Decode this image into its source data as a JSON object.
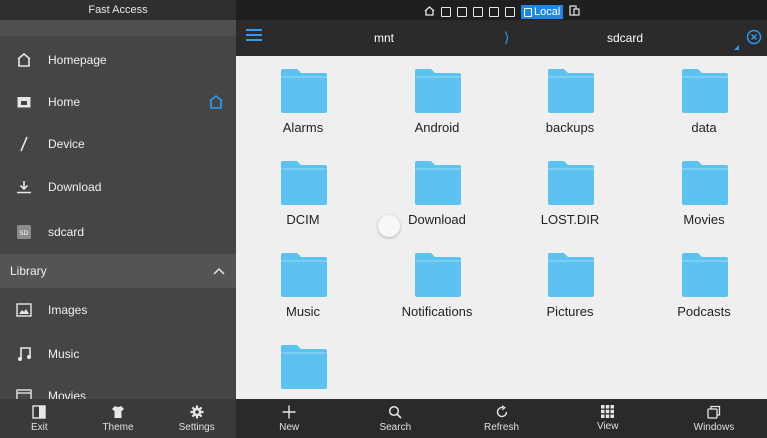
{
  "sidebar": {
    "title": "Fast Access",
    "items": [
      {
        "label": "Homepage",
        "icon": "homepage-icon"
      },
      {
        "label": "Home",
        "icon": "folder-home-icon",
        "trail_icon": "home-outline-icon"
      },
      {
        "label": "Device",
        "icon": "slash-device-icon"
      },
      {
        "label": "Download",
        "icon": "download-icon"
      },
      {
        "label": "sdcard",
        "icon": "sd-card-icon"
      }
    ],
    "library": {
      "label": "Library",
      "items": [
        {
          "label": "Images",
          "icon": "image-icon"
        },
        {
          "label": "Music",
          "icon": "music-note-icon"
        },
        {
          "label": "Movies",
          "icon": "film-icon"
        }
      ]
    }
  },
  "status": {
    "local_label": "Local"
  },
  "pathbar": {
    "crumbs": [
      "mnt",
      "sdcard"
    ],
    "separator": "⟩"
  },
  "folders": [
    "Alarms",
    "Android",
    "backups",
    "data",
    "DCIM",
    "Download",
    "LOST.DIR",
    "Movies",
    "Music",
    "Notifications",
    "Pictures",
    "Podcasts",
    ""
  ],
  "bottom_left": [
    {
      "label": "Exit",
      "icon": "exit-icon"
    },
    {
      "label": "Theme",
      "icon": "shirt-icon"
    },
    {
      "label": "Settings",
      "icon": "gear-icon"
    }
  ],
  "bottom_right": [
    {
      "label": "New",
      "icon": "plus-icon"
    },
    {
      "label": "Search",
      "icon": "search-icon"
    },
    {
      "label": "Refresh",
      "icon": "refresh-icon"
    },
    {
      "label": "View",
      "icon": "grid-view-icon"
    },
    {
      "label": "Windows",
      "icon": "windows-icon"
    }
  ],
  "colors": {
    "accent": "#2e9cf4",
    "folder": "#5bc2f2",
    "sidebar_bg": "#454545",
    "content_bg": "#efefef"
  }
}
